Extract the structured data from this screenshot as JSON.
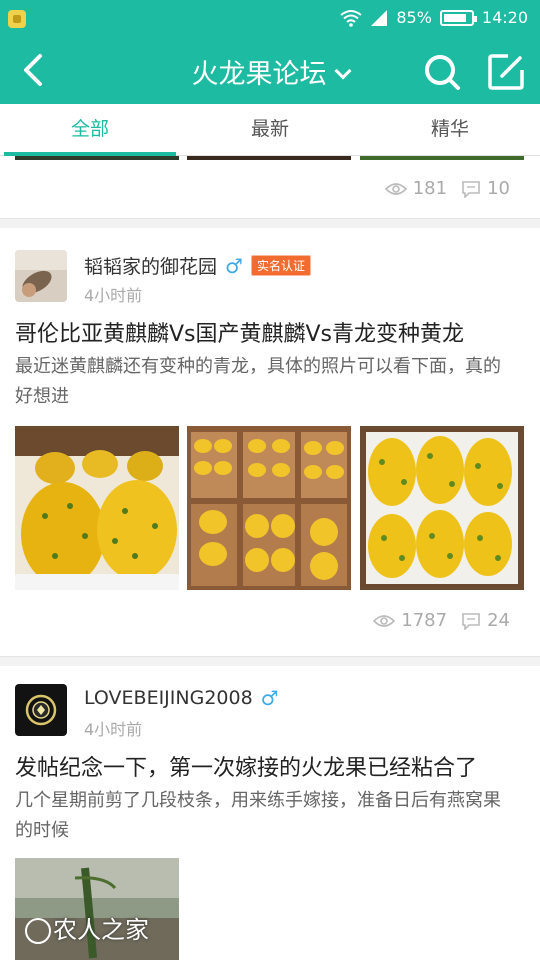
{
  "status_bar": {
    "battery": "85%",
    "time": "14:20"
  },
  "app_bar": {
    "title": "火龙果论坛"
  },
  "tabs": [
    {
      "label": "全部",
      "active": true
    },
    {
      "label": "最新",
      "active": false
    },
    {
      "label": "精华",
      "active": false
    }
  ],
  "posts": [
    {
      "views": "181",
      "comments": "10"
    },
    {
      "author": "韬韬家的御花园",
      "badge": "实名认证",
      "gender_symbol": "♂",
      "time": "4小时前",
      "title": "哥伦比亚黄麒麟Vs国产黄麒麟Vs青龙变种黄龙",
      "excerpt": "最近迷黄麒麟还有变种的青龙，具体的照片可以看下面，真的好想进",
      "views": "1787",
      "comments": "24"
    },
    {
      "author": "LOVEBEIJING2008",
      "gender_symbol": "♂",
      "time": "4小时前",
      "title": "发帖纪念一下，第一次嫁接的火龙果已经粘合了",
      "excerpt": "几个星期前剪了几段枝条，用来练手嫁接，准备日后有燕窝果的时候",
      "watermark": "农人之家"
    }
  ],
  "colors": {
    "accent": "#1ebba3",
    "male": "#3fa8e6",
    "badge": "#f26b2f"
  }
}
